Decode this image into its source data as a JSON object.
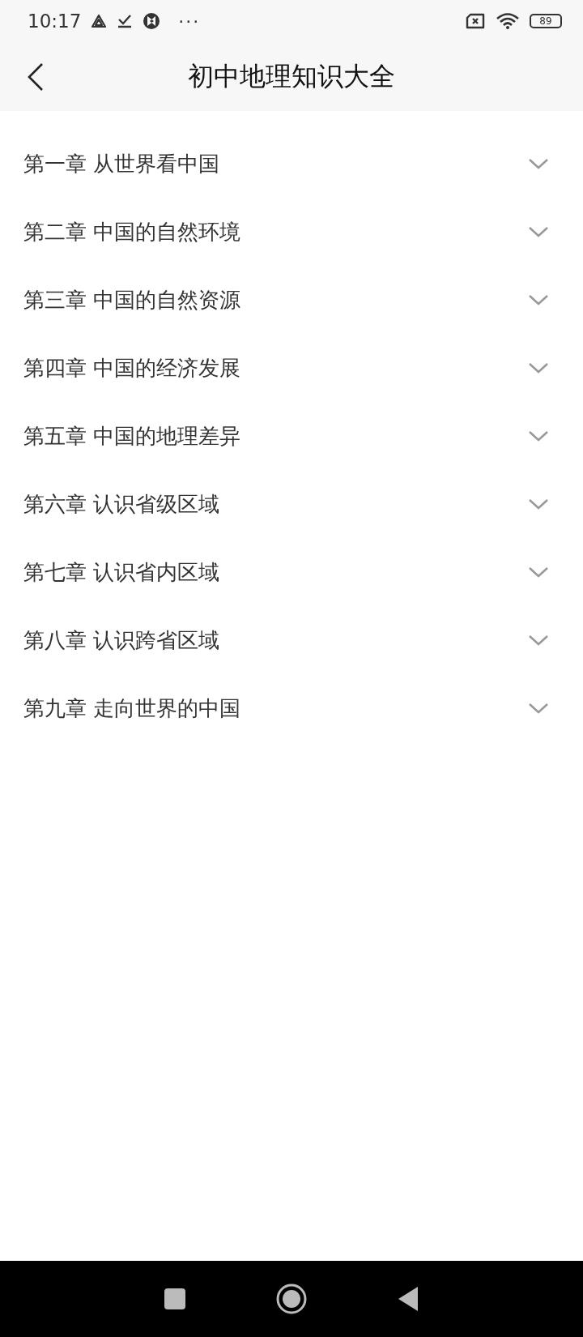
{
  "status_bar": {
    "time": "10:17",
    "overflow": "···",
    "battery": "89"
  },
  "header": {
    "title": "初中地理知识大全"
  },
  "chapters": [
    {
      "label": "第一章 从世界看中国",
      "expanded": false
    },
    {
      "label": "第二章 中国的自然环境",
      "expanded": false
    },
    {
      "label": "第三章 中国的自然资源",
      "expanded": false
    },
    {
      "label": "第四章 中国的经济发展",
      "expanded": false
    },
    {
      "label": "第五章 中国的地理差异",
      "expanded": false
    },
    {
      "label": "第六章 认识省级区域",
      "expanded": false
    },
    {
      "label": "第七章 认识省内区域",
      "expanded": false
    },
    {
      "label": "第八章 认识跨省区域",
      "expanded": false
    },
    {
      "label": "第九章 走向世界的中国",
      "expanded": false
    }
  ]
}
